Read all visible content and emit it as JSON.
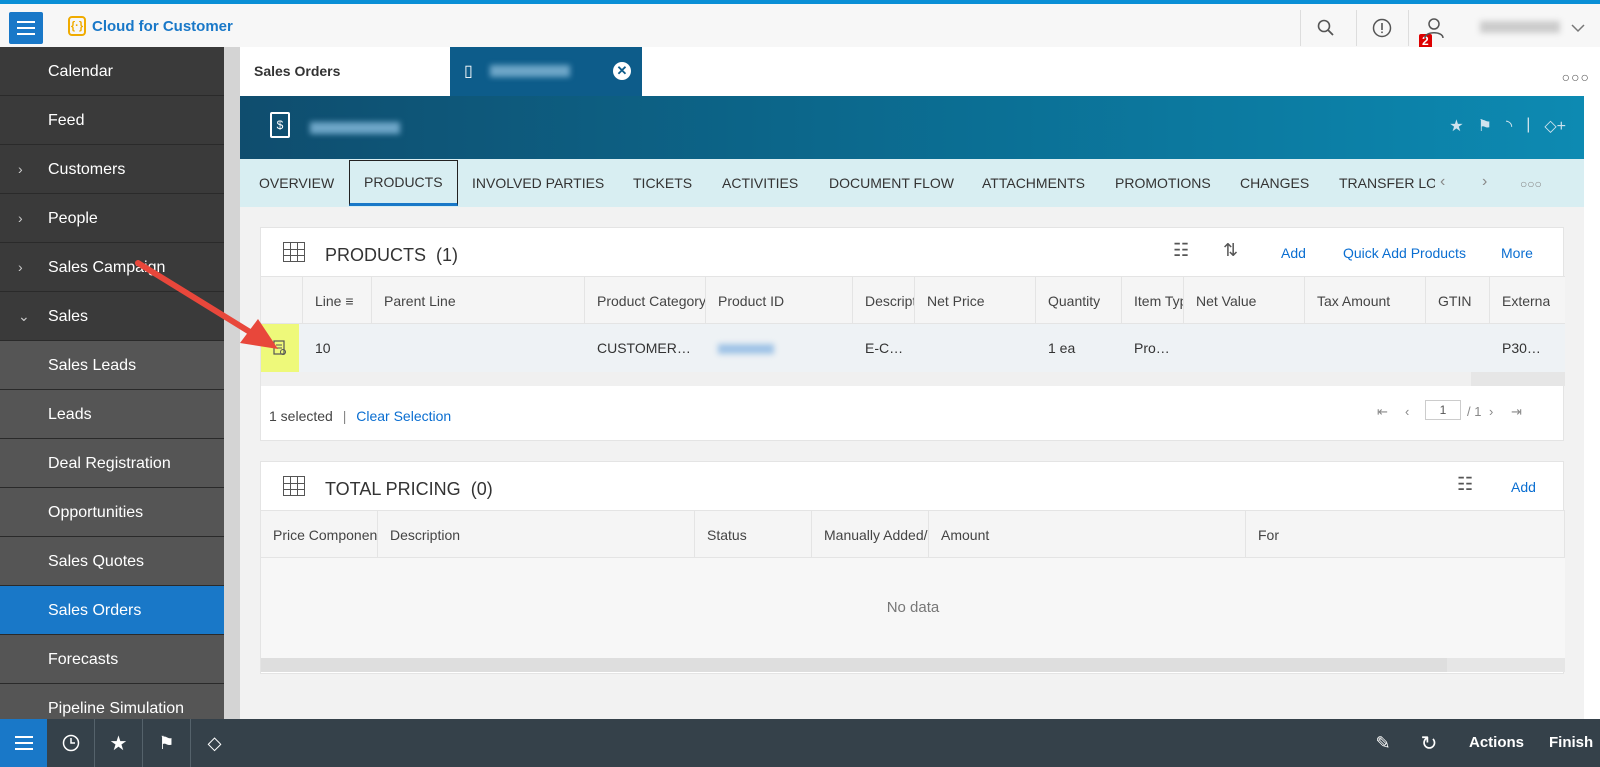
{
  "app": {
    "title": "Cloud for Customer",
    "alerts_count": "2"
  },
  "sidebar": {
    "items": [
      {
        "label": "Calendar"
      },
      {
        "label": "Feed"
      },
      {
        "label": "Customers",
        "expandable": true
      },
      {
        "label": "People",
        "expandable": true
      },
      {
        "label": "Sales Campaign",
        "expandable": true
      },
      {
        "label": "Sales",
        "expanded": true
      },
      {
        "label": "Sales Leads"
      },
      {
        "label": "Leads"
      },
      {
        "label": "Deal Registration"
      },
      {
        "label": "Opportunities"
      },
      {
        "label": "Sales Quotes"
      },
      {
        "label": "Sales Orders",
        "active": true
      },
      {
        "label": "Forecasts"
      },
      {
        "label": "Pipeline Simulation"
      }
    ]
  },
  "doc_tabs": {
    "first": "Sales Orders"
  },
  "section_tabs": [
    "OVERVIEW",
    "PRODUCTS",
    "INVOLVED PARTIES",
    "TICKETS",
    "ACTIVITIES",
    "DOCUMENT FLOW",
    "ATTACHMENTS",
    "PROMOTIONS",
    "CHANGES",
    "TRANSFER LO"
  ],
  "products": {
    "title": "PRODUCTS",
    "count": "(1)",
    "actions": {
      "add": "Add",
      "quick_add": "Quick Add Products",
      "more": "More"
    },
    "columns": [
      "Line",
      "Parent Line",
      "Product Category",
      "Product ID",
      "Descript",
      "Net Price",
      "Quantity",
      "Item Typ",
      "Net Value",
      "Tax Amount",
      "GTIN",
      "Externa"
    ],
    "row": {
      "line": "10",
      "parent_line": "",
      "category": "CUSTOMER…",
      "description": "E-C…",
      "net_price": "",
      "quantity": "1 ea",
      "item_type": "Pro…",
      "net_value": "",
      "tax_amount": "",
      "gtin": "",
      "external": "P30…"
    },
    "selected_text": "1 selected",
    "clear_selection": "Clear Selection",
    "pager": {
      "page": "1",
      "of": "/ 1"
    }
  },
  "pricing": {
    "title": "TOTAL PRICING",
    "count": "(0)",
    "add": "Add",
    "columns": [
      "Price Componen",
      "Description",
      "Status",
      "Manually Added/",
      "Amount",
      "For"
    ],
    "empty": "No data"
  },
  "footer": {
    "actions": "Actions",
    "finish": "Finish"
  },
  "colors": {
    "accent": "#1978c8",
    "header": "#0b6f94",
    "highlight": "#eef97a",
    "annotation_arrow": "#e8473b"
  }
}
